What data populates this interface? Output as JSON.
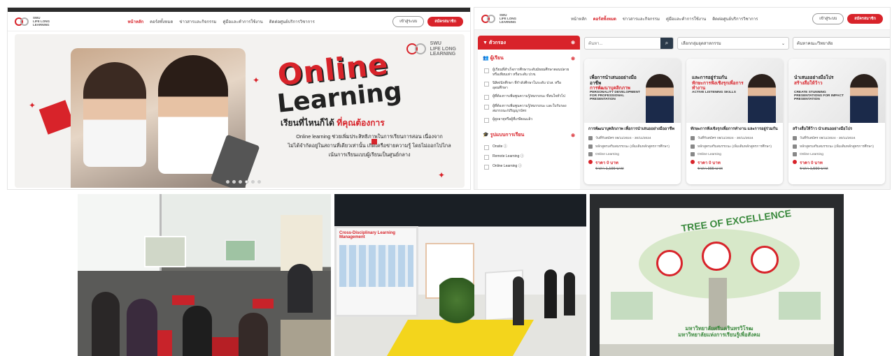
{
  "site1": {
    "logo": {
      "line1": "SWU",
      "line2": "LIFE LONG",
      "line3": "LEARNING"
    },
    "nav": [
      "หน้าหลัก",
      "คอร์สทั้งหมด",
      "ข่าวสารและกิจกรรม",
      "คู่มือและคำการใช้งาน",
      "ติดต่อศูนย์บริการวิชาการ"
    ],
    "login": "เข้าสู่ระบบ",
    "register": "สมัครสมาชิก",
    "hero": {
      "brand": {
        "line1": "SWU",
        "line2": "LIFE LONG",
        "line3": "LEARNING"
      },
      "headline1": "Online",
      "headline2": "Learning",
      "tagline_a": "เรียนที่ไหนก็ได้ ",
      "tagline_b": "ที่คุณต้องการ",
      "body1": "Online learning ช่วยเพิ่มประสิทธิภาพในการเรียนการสอน เนื่องจาก",
      "body2": "ไม่ได้จำกัดอยู่ในสถานที่เดียวเท่านั้น เกิดเครือข่ายความรู้ โดยไม่ออกไปไกล",
      "body3": "เน้นการเรียนแบบผู้เรียนเป็นศูนย์กลาง",
      "slides": 6,
      "active_slide": 3
    }
  },
  "site2": {
    "logo": {
      "line1": "SWU",
      "line2": "LIFE LONG",
      "line3": "LEARNING"
    },
    "nav": [
      "หน้าหลัก",
      "คอร์สทั้งหมด",
      "ข่าวสารและกิจกรรม",
      "คู่มือและคำการใช้งาน",
      "ติดต่อศูนย์บริการวิชาการ"
    ],
    "login": "เข้าสู่ระบบ",
    "register": "สมัครสมาชิก",
    "filter_label": "ตัวกรอง",
    "learners_label": "ผู้เรียน",
    "learners": [
      "ผู้เรียนที่สำเร็จการศึกษาระดับมัธยมศึกษาตอนปลาย หรือเทียบเท่า หรือระดับ ปวช.",
      "นิสิต/นักศึกษา ที่กำลังศึกษาในระดับ ปวส. หรือ อุดมศึกษา",
      "ผู้ที่ต้องการเพิ่มพูนความรู้/สมรรถนะ ที่สนใจทั่วไป",
      "ผู้ที่ต้องการเพิ่มพูนความรู้/สมรรถนะ และใบรับรอง สมรรถนะ/ปริญญาบัตร",
      "ผู้สูงอายุหรือผู้ที่เกษียณแล้ว"
    ],
    "format_label": "รูปแบบการเรียน",
    "formats": [
      "Onsite ⓘ",
      "Remote Learning ⓘ",
      "Online Learning ⓘ"
    ],
    "search_placeholder": "ค้นหา...",
    "select1": "เลือกกลุ่มอุตสาหกรรม",
    "select2": "ค้นหาคณะ/วิทยาลัย",
    "cards": [
      {
        "img_title_a": "การพัฒนาบุคลิกภาพ",
        "img_title_b": "เพื่อการนำเสนออย่างมืออาชีพ",
        "img_en": "PERSONALITY DEVELOPMENT FOR PROFESSIONAL PRESENTATION",
        "title": "การพัฒนาบุคลิกภาพ เพื่อการนำเสนออย่างมืออาชีพ",
        "dates": "วันที่รับสมัคร 08/11/2024 - 30/11/2024",
        "type": "หลักสูตรเสริมสมรรถนะ (เพิ่มเติมหลักสูตรการศึกษา)",
        "mode": "Online Learning",
        "price": "ราคา 0 บาท",
        "old_price": "ราคา 1,199 บาท"
      },
      {
        "img_title_a": "ทักษะการฟังเชิงรุกเพื่อการทำงาน",
        "img_title_b": "และการอยู่ร่วมกัน",
        "img_en": "ACTIVE LISTENING SKILLS",
        "title": "ทักษะการฟังเชิงรุกเพื่อการทำงาน และการอยู่ร่วมกัน",
        "dates": "วันที่รับสมัคร 08/11/2024 - 30/11/2024",
        "type": "หลักสูตรเสริมสมรรถนะ (เพิ่มเติมหลักสูตรการศึกษา)",
        "mode": "Online Learning",
        "price": "ราคา 0 บาท",
        "old_price": "ราคา 999 บาท"
      },
      {
        "img_title_a": "สร้างสื่อให้ว้าว",
        "img_title_b": "นำเสนออย่างมือโปร",
        "img_en": "CREATE STUNNING PRESENTATIONS FOR IMPACT PRESENTATION",
        "title": "สร้างสื่อให้ว้าว นำเสนออย่างมือโปร",
        "dates": "วันที่รับสมัคร 08/11/2024 - 30/11/2024",
        "type": "หลักสูตรเสริมสมรรถนะ (เพิ่มเติมหลักสูตรการศึกษา)",
        "mode": "Online Learning",
        "price": "ราคา 0 บาท",
        "old_price": "ราคา 1,590 บาท"
      }
    ]
  },
  "photos": {
    "p2_board": "Cross-Disciplinary Learning Management",
    "p3_title": "TREE OF EXCELLENCE",
    "p3_caption1": "มหาวิทยาลัยศรีนครินทรวิโรฒ",
    "p3_caption2": "มหาวิทยาลัยแห่งการเรียนรู้เพื่อสังคม"
  },
  "colors": {
    "accent": "#d8232a",
    "dark": "#2b2b2b"
  }
}
